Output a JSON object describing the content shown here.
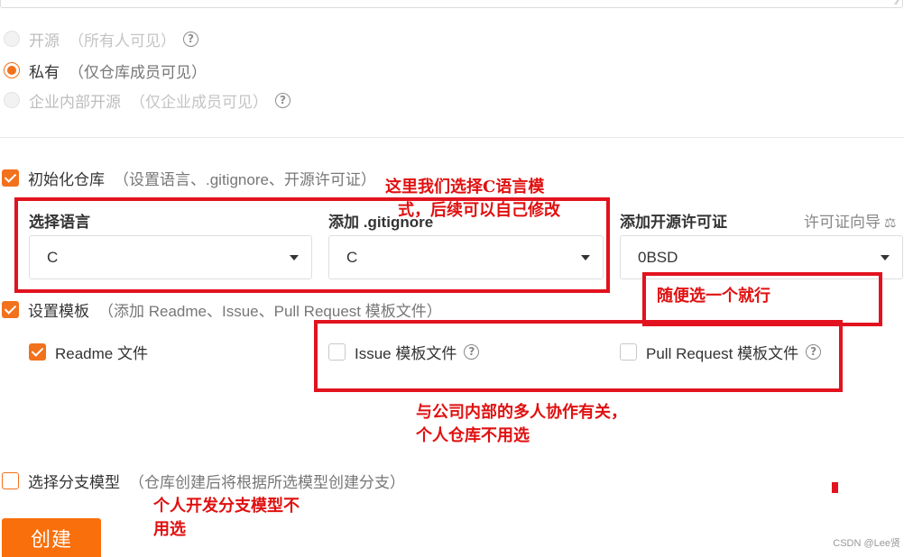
{
  "visibility": {
    "options": [
      {
        "label": "开源",
        "hint": "（所有人可见）",
        "selected": false,
        "disabled": true,
        "has_help": true
      },
      {
        "label": "私有",
        "hint": "（仅仓库成员可见）",
        "selected": true,
        "disabled": false,
        "has_help": false
      },
      {
        "label": "企业内部开源",
        "hint": "（仅企业成员可见）",
        "selected": false,
        "disabled": true,
        "has_help": true
      }
    ]
  },
  "init_repo": {
    "label": "初始化仓库",
    "hint": "（设置语言、.gitignore、开源许可证）",
    "checked": true
  },
  "language": {
    "label": "选择语言",
    "value": "C"
  },
  "gitignore": {
    "label": "添加 .gitignore",
    "value": "C"
  },
  "license": {
    "label": "添加开源许可证",
    "value": "0BSD",
    "guide_label": "许可证向导"
  },
  "template": {
    "label": "设置模板",
    "hint": "（添加 Readme、Issue、Pull Request 模板文件）",
    "checked": true,
    "readme": {
      "label": "Readme 文件",
      "checked": true
    },
    "issue": {
      "label": "Issue 模板文件",
      "checked": false
    },
    "pull_request": {
      "label": "Pull Request 模板文件",
      "checked": false
    }
  },
  "branch_model": {
    "label": "选择分支模型",
    "hint": "（仓库创建后将根据所选模型创建分支）",
    "checked": false
  },
  "create_button": {
    "label": "创建"
  },
  "annotations": {
    "note_language_1": "这里我们选择C语言模",
    "note_language_2": "式，后续可以自己修改",
    "note_license": "随便选一个就行",
    "note_template_1": "与公司内部的多人协作有关，",
    "note_template_2": "个人仓库不用选",
    "note_branch_1": "个人开发分支模型不",
    "note_branch_2": "用选",
    "color": "#e2121e"
  },
  "watermark": "CSDN @Lee贤",
  "icons": {
    "help": "question-circle-icon",
    "caret": "caret-down-icon",
    "scale": "scale-icon"
  },
  "colors": {
    "accent": "#f2711c",
    "button": "#f96f0c"
  }
}
